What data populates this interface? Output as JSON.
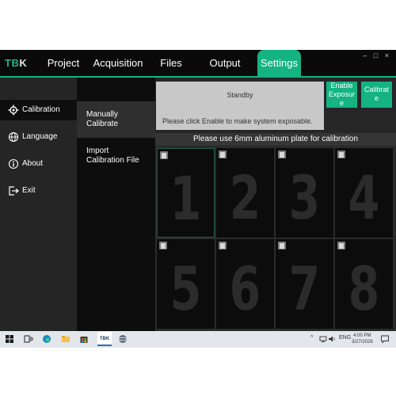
{
  "app": {
    "logo": {
      "main": "TB",
      "accent": "K"
    },
    "tabs": [
      "Project",
      "Acquisition",
      "Files",
      "Output",
      "Settings"
    ],
    "active_tab": "Settings",
    "window_controls": "– □ ×"
  },
  "nav": {
    "items": [
      {
        "label": "Calibration",
        "icon": "gear-icon"
      },
      {
        "label": "Language",
        "icon": "globe-icon"
      },
      {
        "label": "About",
        "icon": "info-icon"
      },
      {
        "label": "Exit",
        "icon": "exit-icon"
      }
    ]
  },
  "subnav": {
    "items": [
      {
        "label": "Manually\nCalibrate"
      },
      {
        "label": "Import\nCalibration File"
      }
    ]
  },
  "status": {
    "title": "Standby",
    "message": "Please click Enable to make system exposable."
  },
  "buttons": {
    "enable": [
      "Enable",
      "Exposur",
      "e"
    ],
    "calibrate": [
      "Calibrat",
      "e"
    ]
  },
  "hint": "Please use 6mm aluminum plate for calibration",
  "plates": [
    "1",
    "2",
    "3",
    "4",
    "5",
    "6",
    "7",
    "8"
  ],
  "taskbar": {
    "tbk_label": "TBK",
    "tray_lang": "ENG",
    "time": "4:00 PM",
    "date": "3/27/2026"
  },
  "colors": {
    "accent": "#14b37f",
    "background": "#1b1b1b",
    "status_bg": "#c8c8c8"
  }
}
